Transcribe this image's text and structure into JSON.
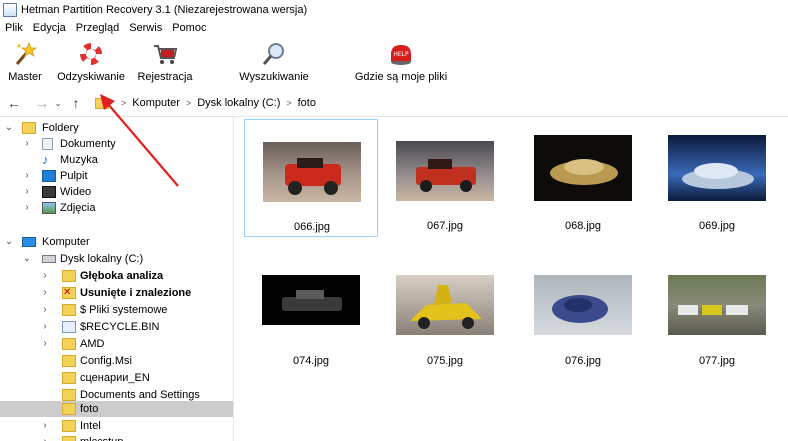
{
  "window": {
    "title": "Hetman Partition Recovery 3.1 (Niezarejestrowana wersja)"
  },
  "menu": [
    "Plik",
    "Edycja",
    "Przegląd",
    "Serwis",
    "Pomoc"
  ],
  "toolbar": {
    "master": "Master",
    "recover": "Odzyskiwanie",
    "register": "Rejestracja",
    "search": "Wyszukiwanie",
    "where_files": "Gdzie są moje pliki"
  },
  "path": [
    "Komputer",
    "Dysk lokalny (C:)",
    "foto"
  ],
  "tree": {
    "folders_root": "Foldery",
    "folders": [
      "Dokumenty",
      "Muzyka",
      "Pulpit",
      "Wideo",
      "Zdjęcia"
    ],
    "computer_root": "Komputer",
    "drive": "Dysk lokalny (C:)",
    "drive_items": [
      "Głęboka analiza",
      "Usunięte i znalezione",
      "$ Pliki systemowe",
      "$RECYCLE.BIN",
      "AMD",
      "Config.Msi",
      "сценарии_EN",
      "Documents and Settings",
      "foto",
      "Intel",
      "mlccstup"
    ]
  },
  "files": [
    "066.jpg",
    "067.jpg",
    "068.jpg",
    "069.jpg",
    "074.jpg",
    "075.jpg",
    "076.jpg",
    "077.jpg"
  ],
  "colors": {
    "accent_arrow": "#e02020",
    "selection": "#cccccc",
    "selected_border": "#99d1ff"
  }
}
